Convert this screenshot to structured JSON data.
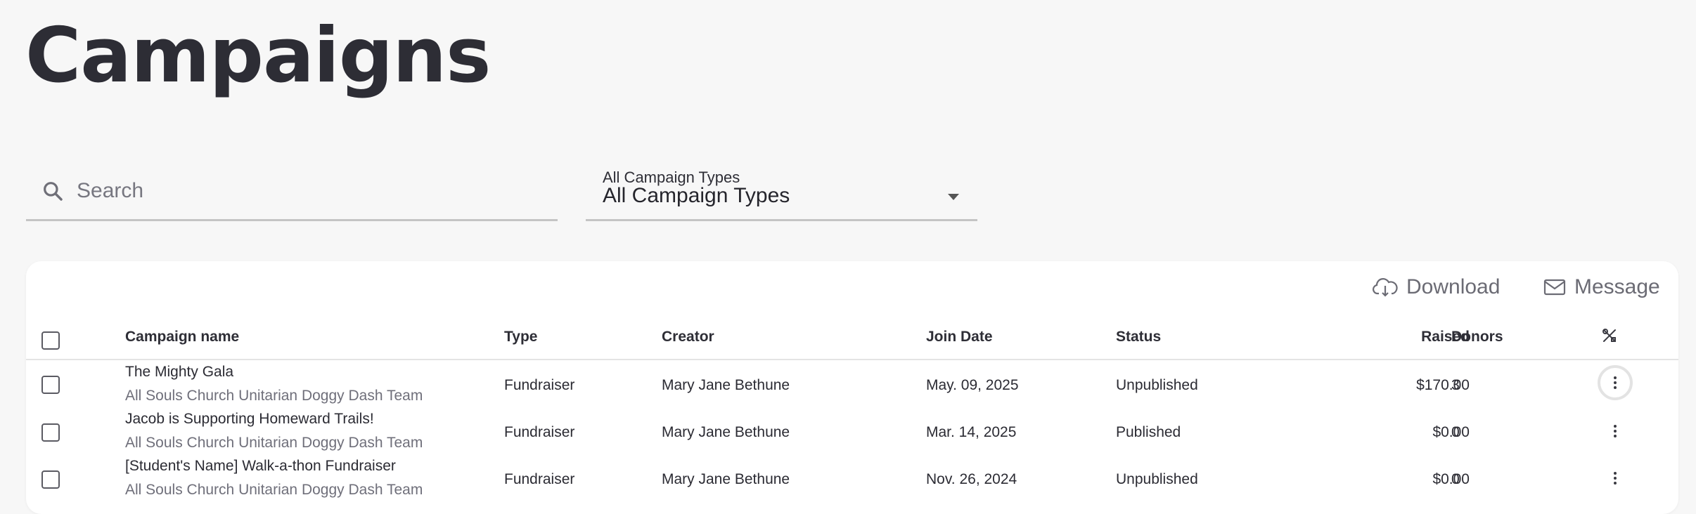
{
  "page": {
    "title": "Campaigns"
  },
  "search": {
    "placeholder": "Search",
    "value": ""
  },
  "filter": {
    "label": "All Campaign Types",
    "selected": "All Campaign Types"
  },
  "toolbar": {
    "download_label": "Download",
    "message_label": "Message"
  },
  "table": {
    "columns": {
      "name": "Campaign name",
      "type": "Type",
      "creator": "Creator",
      "join_date": "Join Date",
      "status": "Status",
      "raised": "Raised",
      "donors": "Donors"
    },
    "rows": [
      {
        "name": "The Mighty Gala",
        "team": "All Souls Church Unitarian Doggy Dash Team",
        "type": "Fundraiser",
        "creator": "Mary Jane Bethune",
        "join_date": "May. 09, 2025",
        "status": "Unpublished",
        "raised": "$170.00",
        "donors": "3"
      },
      {
        "name": "Jacob is Supporting Homeward Trails!",
        "team": "All Souls Church Unitarian Doggy Dash Team",
        "type": "Fundraiser",
        "creator": "Mary Jane Bethune",
        "join_date": "Mar. 14, 2025",
        "status": "Published",
        "raised": "$0.00",
        "donors": "0"
      },
      {
        "name": "[Student's Name] Walk-a-thon Fundraiser",
        "team": "All Souls Church Unitarian Doggy Dash Team",
        "type": "Fundraiser",
        "creator": "Mary Jane Bethune",
        "join_date": "Nov. 26, 2024",
        "status": "Unpublished",
        "raised": "$0.00",
        "donors": "0"
      }
    ]
  },
  "icons": {
    "search": "search-icon",
    "download": "cloud-download-icon",
    "message": "mail-icon",
    "columns": "tools-icon",
    "row_menu": "more-vertical-icon"
  }
}
